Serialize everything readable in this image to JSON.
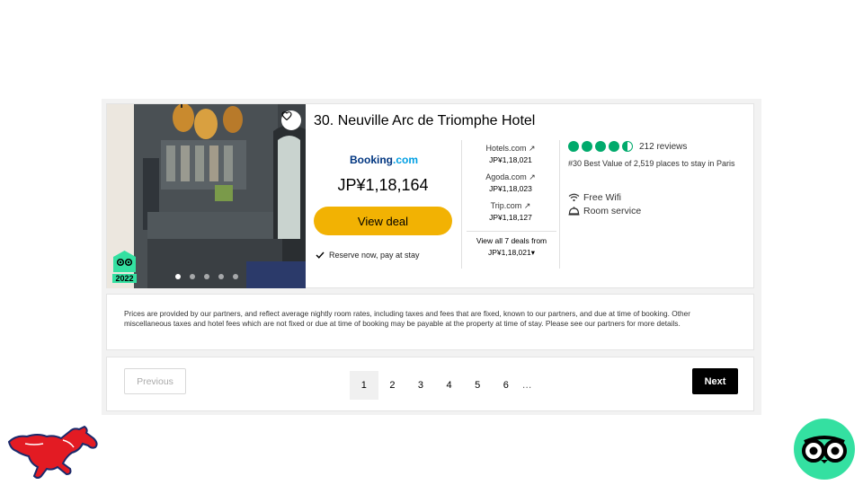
{
  "hotel": {
    "title": "30. Neuville Arc de Triomphe Hotel",
    "award_year": "2022",
    "photo_count": 5,
    "active_photo": 1
  },
  "main_offer": {
    "provider_name": "Booking",
    "provider_suffix": ".com",
    "price": "JP¥1,18,164",
    "cta_label": "View deal",
    "reserve_note": "Reserve now, pay at stay"
  },
  "partners": [
    {
      "name": "Hotels.com",
      "price": "JP¥1,18,021"
    },
    {
      "name": "Agoda.com",
      "price": "JP¥1,18,023"
    },
    {
      "name": "Trip.com",
      "price": "JP¥1,18,127"
    }
  ],
  "view_all": {
    "line1": "View all 7 deals from",
    "line2": "JP¥1,18,021"
  },
  "rating": {
    "bubbles": 4.5,
    "reviews": "212 reviews",
    "rank": "#30 Best Value of 2,519 places to stay in Paris"
  },
  "amenities": [
    "Free Wifi",
    "Room service"
  ],
  "disclaimer": "Prices are provided by our partners, and reflect average nightly room rates, including taxes and fees that are fixed, known to our partners, and due at time of booking. Other miscellaneous taxes and hotel fees which are not fixed or due at time of booking may be payable at the property at time of stay. Please see our partners for more details.",
  "pagination": {
    "previous_label": "Previous",
    "next_label": "Next",
    "pages": [
      "1",
      "2",
      "3",
      "4",
      "5",
      "6"
    ],
    "current": "1",
    "ellipsis": "…"
  },
  "colors": {
    "accent_yellow": "#f2b203",
    "tripadvisor_green": "#00aa6c",
    "logo_mint": "#34e0a1",
    "booking_blue": "#003580",
    "mustang_red": "#e31b23"
  }
}
